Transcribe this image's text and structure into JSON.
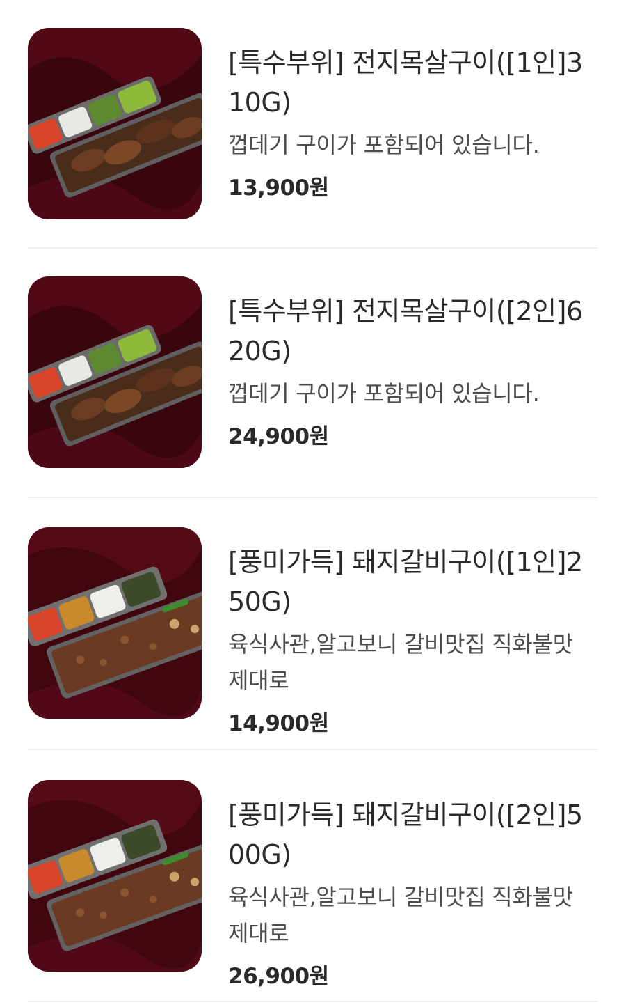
{
  "menu_items": [
    {
      "title": "[특수부위] 전지목살구이([1인]310G)",
      "description": "껍데기 구이가 포함되어 있습니다.",
      "price": "13,900원",
      "image": "grilled-pork-neck-lunchbox-image"
    },
    {
      "title": "[특수부위] 전지목살구이([2인]620G)",
      "description": "껍데기 구이가 포함되어 있습니다.",
      "price": "24,900원",
      "image": "grilled-pork-neck-lunchbox-image"
    },
    {
      "title": "[풍미가득] 돼지갈비구이([1인]250G)",
      "description": "육식사관,알고보니 갈비맛집 직화불맛 제대로",
      "price": "14,900원",
      "image": "grilled-pork-ribs-lunchbox-image"
    },
    {
      "title": "[풍미가득] 돼지갈비구이([2인]500G)",
      "description": "육식사관,알고보니 갈비맛집 직화불맛 제대로",
      "price": "26,900원",
      "image": "grilled-pork-ribs-lunchbox-image"
    }
  ],
  "colors": {
    "background": "#ffffff",
    "title_text": "#2a2a2a",
    "description_text": "#4d4d4d",
    "divider": "#efefef",
    "velvet_backdrop": "#4a0a12"
  }
}
